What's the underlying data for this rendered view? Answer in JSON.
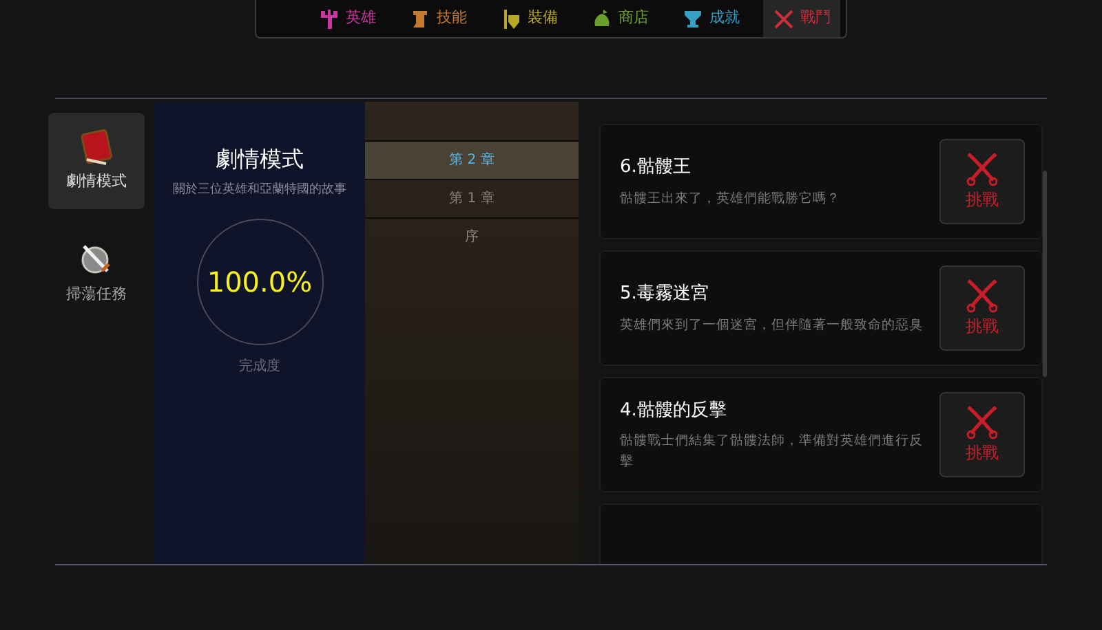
{
  "nav": {
    "tabs": [
      {
        "label": "英雄",
        "color": "#c8389e",
        "kind": "hero",
        "selected": false
      },
      {
        "label": "技能",
        "color": "#c47a2e",
        "kind": "skill",
        "selected": false
      },
      {
        "label": "裝備",
        "color": "#b8a828",
        "kind": "gear",
        "selected": false
      },
      {
        "label": "商店",
        "color": "#6c9e2c",
        "kind": "shop",
        "selected": false
      },
      {
        "label": "成就",
        "color": "#34a0c4",
        "kind": "trophy",
        "selected": false
      },
      {
        "label": "戰鬥",
        "color": "#c8303c",
        "kind": "battle",
        "selected": true
      }
    ]
  },
  "sidebar": {
    "items": [
      {
        "label": "劇情模式",
        "kind": "book",
        "selected": true
      },
      {
        "label": "掃蕩任務",
        "kind": "sword",
        "selected": false
      }
    ]
  },
  "story": {
    "title": "劇情模式",
    "subtitle": "關於三位英雄和亞蘭特國的故事",
    "progress": "100.0%",
    "progress_label": "完成度"
  },
  "chapters": [
    {
      "label": "第 2 章",
      "selected": true
    },
    {
      "label": "第 1 章",
      "selected": false
    },
    {
      "label": "序",
      "selected": false
    }
  ],
  "quests": [
    {
      "title": "6.骷髏王",
      "description": "骷髏王出來了，英雄們能戰勝它嗎？",
      "button": "挑戰"
    },
    {
      "title": "5.毒霧迷宮",
      "description": "英雄們來到了一個迷宮，但伴隨著一般致命的惡臭",
      "button": "挑戰"
    },
    {
      "title": "4.骷髏的反擊",
      "description": "骷髏戰士們結集了骷髏法師，準備對英雄們進行反擊",
      "button": "挑戰"
    }
  ]
}
